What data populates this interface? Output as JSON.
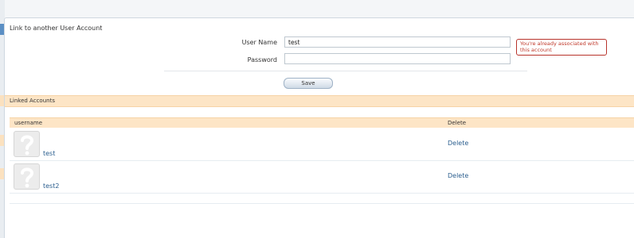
{
  "panel": {
    "title": "Link to another User Account"
  },
  "form": {
    "username_label": "User Name",
    "username_value": "test",
    "password_label": "Password",
    "password_value": "",
    "error_line1": "You're already associated with",
    "error_line2": "this account",
    "save_label": "Save"
  },
  "linked": {
    "heading": "Linked Accounts",
    "columns": {
      "username": "username",
      "delete": "Delete"
    },
    "rows": [
      {
        "username": "test",
        "action": "Delete",
        "avatar_icon": "question-mark-icon"
      },
      {
        "username": "test2",
        "action": "Delete",
        "avatar_icon": "question-mark-icon"
      }
    ]
  },
  "colors": {
    "accent_blue": "#5b8fc4",
    "header_peach": "#fde5c6",
    "link": "#2c5f8f",
    "error": "#c0392b"
  }
}
